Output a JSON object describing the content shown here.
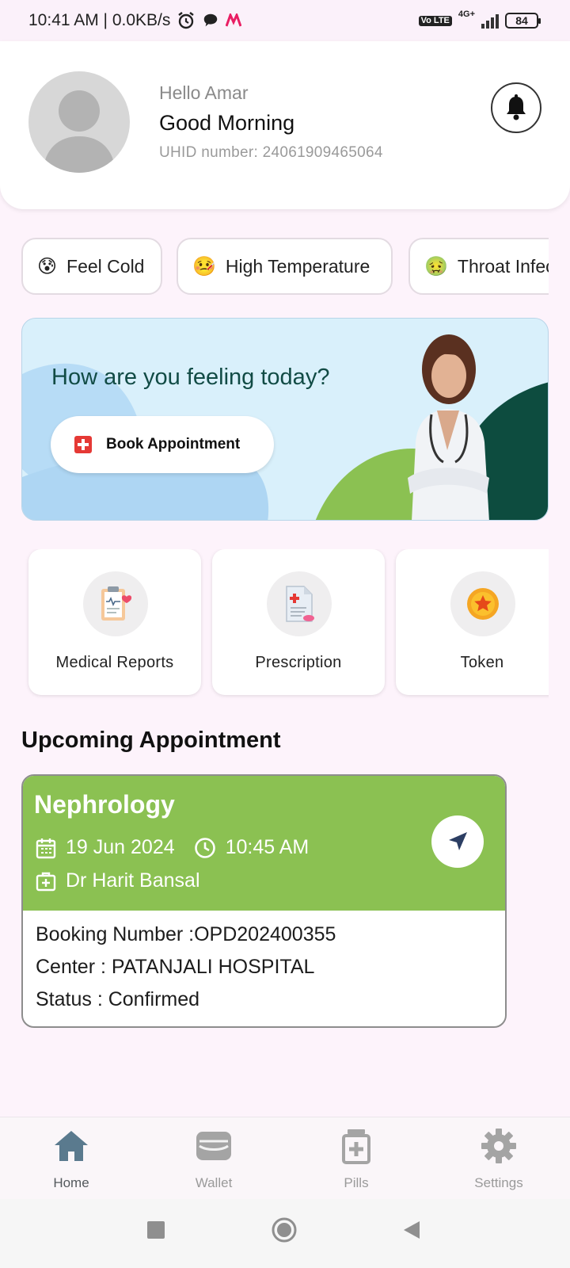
{
  "status_bar": {
    "left_text": "10:41 AM | 0.0KB/s",
    "volte": "Vo LTE",
    "network": "4G+",
    "battery": "84"
  },
  "header": {
    "hello": "Hello Amar",
    "greeting": "Good Morning",
    "uhid": "UHID number: 24061909465064"
  },
  "symptoms": [
    {
      "emoji": "😰",
      "label": "Feel Cold"
    },
    {
      "emoji": "🤒",
      "label": "High Temperature"
    },
    {
      "emoji": "🤢",
      "label": "Throat Infection"
    }
  ],
  "banner": {
    "title": "How are you feeling today?",
    "button_label": "Book Appointment"
  },
  "actions": [
    {
      "label": "Medical Reports",
      "icon": "medical-report-icon"
    },
    {
      "label": "Prescription",
      "icon": "prescription-icon"
    },
    {
      "label": "Token",
      "icon": "token-icon"
    }
  ],
  "upcoming": {
    "title": "Upcoming Appointment",
    "department": "Nephrology",
    "date": "19 Jun 2024",
    "time": "10:45 AM",
    "doctor": "Dr Harit Bansal",
    "booking": "Booking Number :OPD202400355",
    "center": "Center : PATANJALI HOSPITAL",
    "status": "Status : Confirmed"
  },
  "bottom_nav": [
    {
      "label": "Home",
      "icon": "home-icon",
      "active": true
    },
    {
      "label": "Wallet",
      "icon": "wallet-icon",
      "active": false
    },
    {
      "label": "Pills",
      "icon": "pills-icon",
      "active": false
    },
    {
      "label": "Settings",
      "icon": "settings-icon",
      "active": false
    }
  ],
  "colors": {
    "background": "#fdf3fb",
    "appointment_green": "#8bc152",
    "banner_blue": "#d9f0fb",
    "banner_title": "#114b45",
    "active_nav": "#54595d"
  }
}
